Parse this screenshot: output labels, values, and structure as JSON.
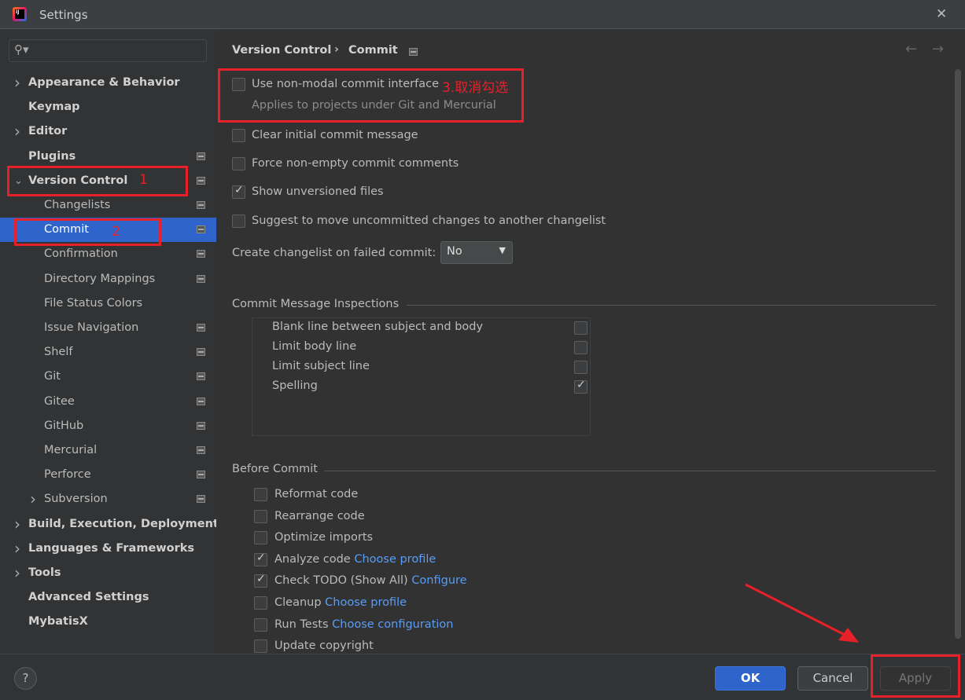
{
  "window": {
    "title": "Settings",
    "close": "✕"
  },
  "sidebar": {
    "items": [
      {
        "label": "Appearance & Behavior",
        "bold": true,
        "chev": "›",
        "proj": false,
        "level": 0
      },
      {
        "label": "Keymap",
        "bold": true,
        "proj": false,
        "level": 0
      },
      {
        "label": "Editor",
        "bold": true,
        "chev": "›",
        "proj": false,
        "level": 0
      },
      {
        "label": "Plugins",
        "bold": true,
        "proj": true,
        "level": 0
      },
      {
        "label": "Version Control",
        "bold": true,
        "chev": "⌄",
        "proj": true,
        "level": 0
      },
      {
        "label": "Changelists",
        "proj": true,
        "level": 1
      },
      {
        "label": "Commit",
        "proj": true,
        "level": 1,
        "selected": true
      },
      {
        "label": "Confirmation",
        "proj": true,
        "level": 1
      },
      {
        "label": "Directory Mappings",
        "proj": true,
        "level": 1
      },
      {
        "label": "File Status Colors",
        "proj": false,
        "level": 1
      },
      {
        "label": "Issue Navigation",
        "proj": true,
        "level": 1
      },
      {
        "label": "Shelf",
        "proj": true,
        "level": 1
      },
      {
        "label": "Git",
        "proj": true,
        "level": 1
      },
      {
        "label": "Gitee",
        "proj": true,
        "level": 1
      },
      {
        "label": "GitHub",
        "proj": true,
        "level": 1
      },
      {
        "label": "Mercurial",
        "proj": true,
        "level": 1
      },
      {
        "label": "Perforce",
        "proj": true,
        "level": 1
      },
      {
        "label": "Subversion",
        "chev": "›",
        "proj": true,
        "level": 1
      },
      {
        "label": "Build, Execution, Deployment",
        "bold": true,
        "chev": "›",
        "proj": false,
        "level": 0
      },
      {
        "label": "Languages & Frameworks",
        "bold": true,
        "chev": "›",
        "proj": false,
        "level": 0
      },
      {
        "label": "Tools",
        "bold": true,
        "chev": "›",
        "proj": false,
        "level": 0
      },
      {
        "label": "Advanced Settings",
        "bold": true,
        "proj": false,
        "level": 0
      },
      {
        "label": "MybatisX",
        "bold": true,
        "proj": false,
        "level": 0
      }
    ]
  },
  "breadcrumb": {
    "parent": "Version Control",
    "sep": "›",
    "current": "Commit"
  },
  "options": {
    "non_modal": {
      "label": "Use non-modal commit interface",
      "checked": false,
      "hint": "Applies to projects under Git and Mercurial"
    },
    "clear_initial": {
      "label": "Clear initial commit message",
      "checked": false
    },
    "force_non_empty": {
      "label": "Force non-empty commit comments",
      "checked": false
    },
    "show_unversioned": {
      "label": "Show unversioned files",
      "checked": true
    },
    "suggest_move": {
      "label": "Suggest to move uncommitted changes to another changelist",
      "checked": false
    },
    "create_changelist": {
      "label": "Create changelist on failed commit:",
      "value": "No"
    }
  },
  "inspections": {
    "title": "Commit Message Inspections",
    "items": [
      {
        "label": "Blank line between subject and body",
        "checked": false
      },
      {
        "label": "Limit body line",
        "checked": false
      },
      {
        "label": "Limit subject line",
        "checked": false
      },
      {
        "label": "Spelling",
        "checked": true
      }
    ]
  },
  "before_commit": {
    "title": "Before Commit",
    "items": [
      {
        "label": "Reformat code",
        "checked": false,
        "link": ""
      },
      {
        "label": "Rearrange code",
        "checked": false,
        "link": ""
      },
      {
        "label": "Optimize imports",
        "checked": false,
        "link": ""
      },
      {
        "label": "Analyze code",
        "checked": true,
        "link": "Choose profile"
      },
      {
        "label": "Check TODO (Show All)",
        "checked": true,
        "link": "Configure"
      },
      {
        "label": "Cleanup",
        "checked": false,
        "link": "Choose profile"
      },
      {
        "label": "Run Tests",
        "checked": false,
        "link": "Choose configuration"
      },
      {
        "label": "Update copyright",
        "checked": false,
        "link": ""
      }
    ]
  },
  "footer": {
    "help": "?",
    "ok": "OK",
    "cancel": "Cancel",
    "apply": "Apply"
  },
  "annotations": {
    "one": "1",
    "two": "2",
    "three": "3.取消勾选"
  },
  "colors": {
    "accent": "#2f65ca",
    "annotation": "#e8202a",
    "link": "#589df6"
  }
}
